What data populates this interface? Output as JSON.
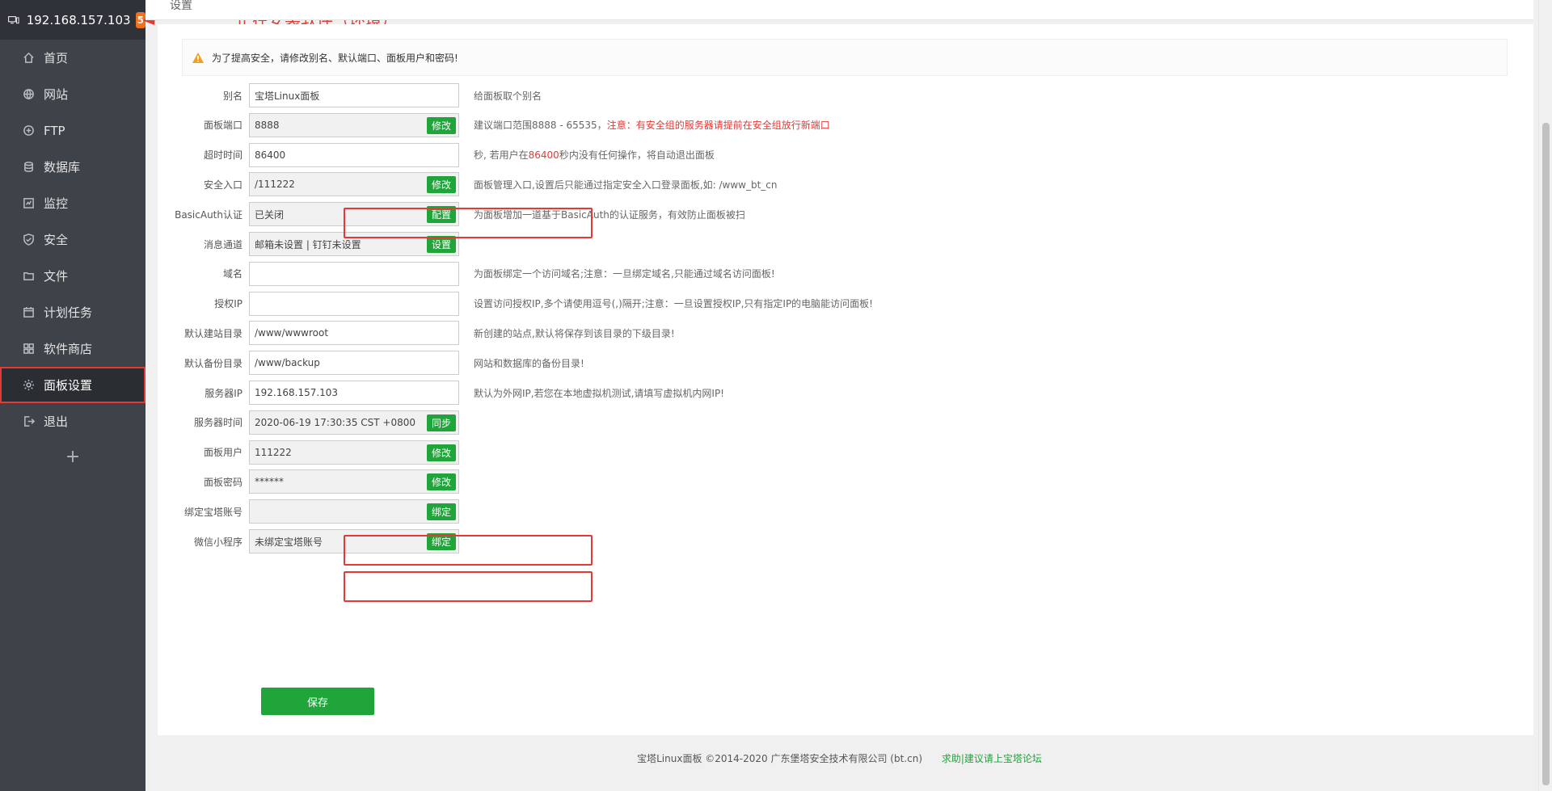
{
  "header": {
    "host": "192.168.157.103",
    "badge": "5"
  },
  "annotation": {
    "text": "正在安装软件（环境）"
  },
  "nav": [
    {
      "label": "首页",
      "icon": "home-icon"
    },
    {
      "label": "网站",
      "icon": "globe-icon"
    },
    {
      "label": "FTP",
      "icon": "ftp-icon"
    },
    {
      "label": "数据库",
      "icon": "database-icon"
    },
    {
      "label": "监控",
      "icon": "monitor-icon"
    },
    {
      "label": "安全",
      "icon": "shield-icon"
    },
    {
      "label": "文件",
      "icon": "folder-icon"
    },
    {
      "label": "计划任务",
      "icon": "calendar-icon"
    },
    {
      "label": "软件商店",
      "icon": "grid-icon"
    },
    {
      "label": "面板设置",
      "icon": "gear-icon",
      "active": true
    },
    {
      "label": "退出",
      "icon": "logout-icon"
    }
  ],
  "nav_add": "+",
  "crumb": "设置",
  "notice": "为了提高安全，请修改别名、默认端口、面板用户和密码!",
  "settings": [
    {
      "label": "别名",
      "value": "宝塔Linux面板",
      "hint": "给面板取个别名"
    },
    {
      "label": "面板端口",
      "value": "8888",
      "button": "修改",
      "hint": "建议端口范围8888 - 65535，",
      "hint_red": "注意：有安全组的服务器请提前在安全组放行新端口"
    },
    {
      "label": "超时时间",
      "value": "86400",
      "hint": "秒, 若用户在",
      "hint_red": "86400",
      "hint_after": "秒内没有任何操作，将自动退出面板"
    },
    {
      "label": "安全入口",
      "value": "/111222",
      "button": "修改",
      "hint": "面板管理入口,设置后只能通过指定安全入口登录面板,如: /www_bt_cn"
    },
    {
      "label": "BasicAuth认证",
      "value": "已关闭",
      "button": "配置",
      "hint": "为面板增加一道基于BasicAuth的认证服务，有效防止面板被扫"
    },
    {
      "label": "消息通道",
      "value": "邮箱未设置 | 钉钉未设置",
      "button": "设置",
      "hint": ""
    },
    {
      "label": "域名",
      "value": "",
      "hint": "为面板绑定一个访问域名;注意：一旦绑定域名,只能通过域名访问面板!"
    },
    {
      "label": "授权IP",
      "value": "",
      "hint": "设置访问授权IP,多个请使用逗号(,)隔开;注意：一旦设置授权IP,只有指定IP的电脑能访问面板!"
    },
    {
      "label": "默认建站目录",
      "value": "/www/wwwroot",
      "hint": "新创建的站点,默认将保存到该目录的下级目录!"
    },
    {
      "label": "默认备份目录",
      "value": "/www/backup",
      "hint": "网站和数据库的备份目录!"
    },
    {
      "label": "服务器IP",
      "value": "192.168.157.103",
      "hint": "默认为外网IP,若您在本地虚拟机测试,请填写虚拟机内网IP!"
    },
    {
      "label": "服务器时间",
      "value": "2020-06-19 17:30:35 CST +0800",
      "button": "同步",
      "hint": ""
    },
    {
      "label": "面板用户",
      "value": "111222",
      "button": "修改",
      "hint": ""
    },
    {
      "label": "面板密码",
      "value": "******",
      "button": "修改",
      "hint": ""
    },
    {
      "label": "绑定宝塔账号",
      "value": "",
      "button": "绑定",
      "hint": ""
    },
    {
      "label": "微信小程序",
      "value": "未绑定宝塔账号",
      "button": "绑定",
      "hint": ""
    }
  ],
  "save_label": "保存",
  "footer": {
    "copyright": "宝塔Linux面板 ©2014-2020 广东堡塔安全技术有限公司 (bt.cn)",
    "link": "求助|建议请上宝塔论坛"
  },
  "colors": {
    "accent": "#20a53a",
    "highlight": "#e53935",
    "sidebar": "#3e4249"
  }
}
